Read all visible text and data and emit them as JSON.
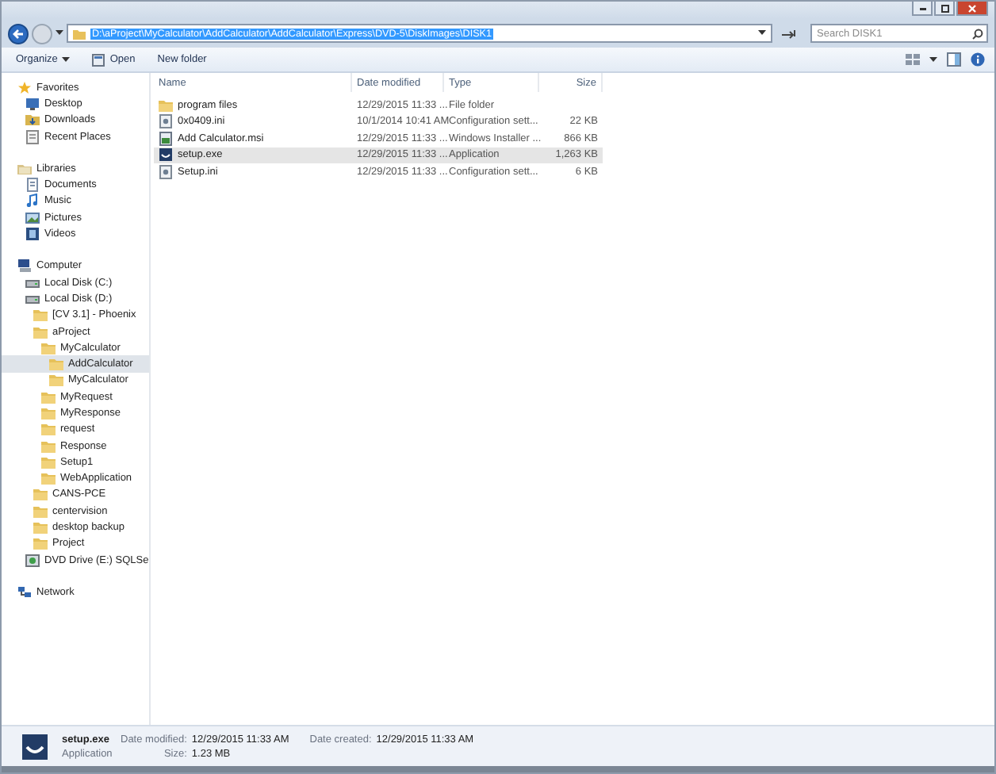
{
  "address_bar": {
    "path": "D:\\aProject\\MyCalculator\\AddCalculator\\AddCalculator\\Express\\DVD-5\\DiskImages\\DISK1",
    "selected": true
  },
  "search": {
    "placeholder": "Search DISK1"
  },
  "toolbar": {
    "items": [
      {
        "label": "Organize",
        "kind": "menu"
      },
      {
        "label": "Open",
        "kind": "open"
      },
      {
        "label": "New folder",
        "kind": "plain"
      }
    ]
  },
  "nav": {
    "items": [
      {
        "label": "Favorites",
        "kind": "star",
        "selected": false,
        "children": [
          {
            "label": "Desktop",
            "kind": "desktop",
            "selected": false
          },
          {
            "label": "Downloads",
            "kind": "downloads",
            "selected": false
          },
          {
            "label": "Recent Places",
            "kind": "recent",
            "selected": false
          }
        ]
      },
      {
        "label": "Libraries",
        "kind": "library",
        "selected": false,
        "children": [
          {
            "label": "Documents",
            "kind": "documents",
            "selected": false
          },
          {
            "label": "Music",
            "kind": "music",
            "selected": false
          },
          {
            "label": "Pictures",
            "kind": "pictures",
            "selected": false
          },
          {
            "label": "Videos",
            "kind": "videos",
            "selected": false
          }
        ]
      },
      {
        "label": "Computer",
        "kind": "computer",
        "selected": false,
        "children": [
          {
            "label": "Local Disk (C:)",
            "kind": "drive",
            "selected": false
          },
          {
            "label": "Local Disk (D:)",
            "kind": "drive",
            "selected": false,
            "children": [
              {
                "label": "[CV 3.1] - Phoenix",
                "kind": "folder",
                "selected": false
              },
              {
                "label": "aProject",
                "kind": "folder",
                "selected": false,
                "children": [
                  {
                    "label": "MyCalculator",
                    "kind": "folder",
                    "selected": false,
                    "children": [
                      {
                        "label": "AddCalculator",
                        "kind": "folder",
                        "selected": true
                      },
                      {
                        "label": "MyCalculator",
                        "kind": "folder",
                        "selected": false
                      }
                    ]
                  },
                  {
                    "label": "MyRequest",
                    "kind": "folder",
                    "selected": false
                  },
                  {
                    "label": "MyResponse",
                    "kind": "folder",
                    "selected": false
                  },
                  {
                    "label": "request",
                    "kind": "folder",
                    "selected": false
                  },
                  {
                    "label": "Response",
                    "kind": "folder",
                    "selected": false
                  },
                  {
                    "label": "Setup1",
                    "kind": "folder",
                    "selected": false
                  },
                  {
                    "label": "WebApplication",
                    "kind": "folder",
                    "selected": false
                  }
                ]
              },
              {
                "label": "CANS-PCE",
                "kind": "folder",
                "selected": false
              },
              {
                "label": "centervision",
                "kind": "folder",
                "selected": false
              },
              {
                "label": "desktop backup",
                "kind": "folder",
                "selected": false
              },
              {
                "label": "Project",
                "kind": "folder",
                "selected": false
              }
            ]
          },
          {
            "label": "DVD Drive (E:) SQLSe",
            "kind": "dvd",
            "selected": false
          }
        ]
      },
      {
        "label": "Network",
        "kind": "network",
        "selected": false
      }
    ]
  },
  "table": {
    "columns": [
      "Name",
      "Date modified",
      "Type",
      "Size"
    ],
    "rows": [
      {
        "name": "program files",
        "date": "12/29/2015 11:33 ...",
        "type": "File folder",
        "size": "",
        "kind": "folder",
        "selected": false
      },
      {
        "name": "0x0409.ini",
        "date": "10/1/2014 10:41 AM",
        "type": "Configuration sett...",
        "size": "22 KB",
        "kind": "config",
        "selected": false
      },
      {
        "name": "Add Calculator.msi",
        "date": "12/29/2015 11:33 ...",
        "type": "Windows Installer ...",
        "size": "866 KB",
        "kind": "installer",
        "selected": false
      },
      {
        "name": "setup.exe",
        "date": "12/29/2015 11:33 ...",
        "type": "Application",
        "size": "1,263 KB",
        "kind": "app",
        "selected": true
      },
      {
        "name": "Setup.ini",
        "date": "12/29/2015 11:33 ...",
        "type": "Configuration sett...",
        "size": "6 KB",
        "kind": "config",
        "selected": false
      }
    ]
  },
  "details": {
    "name": "setup.exe",
    "type": "Application",
    "fields": [
      {
        "label": "Date modified:",
        "value": "12/29/2015 11:33 AM"
      },
      {
        "label": "Size:",
        "value": "1.23 MB"
      },
      {
        "label": "Date created:",
        "value": "12/29/2015 11:33 AM"
      }
    ]
  }
}
